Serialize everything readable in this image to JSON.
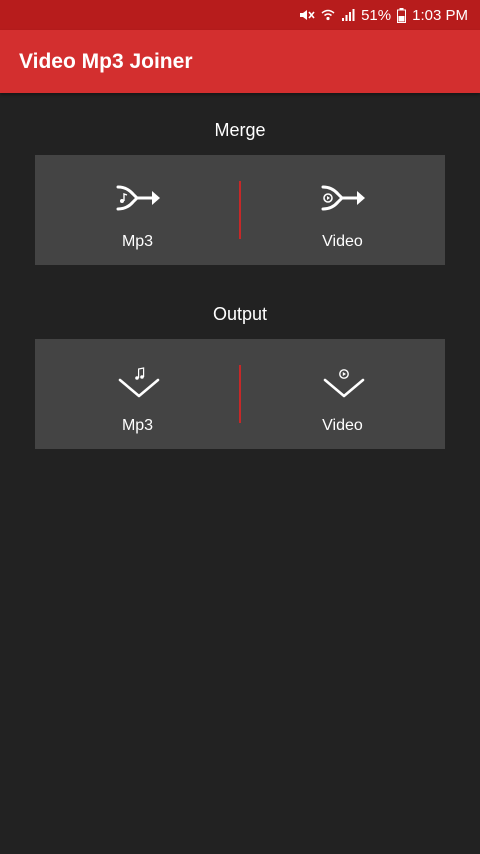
{
  "status_bar": {
    "battery": "51%",
    "time": "1:03 PM",
    "icons": [
      "mute-icon",
      "wifi-icon",
      "signal-icon",
      "battery-icon"
    ]
  },
  "app_bar": {
    "title": "Video Mp3 Joiner"
  },
  "merge": {
    "title": "Merge",
    "mp3_label": "Mp3",
    "video_label": "Video"
  },
  "output": {
    "title": "Output",
    "mp3_label": "Mp3",
    "video_label": "Video"
  },
  "colors": {
    "accent": "#d32f2f",
    "status_bar": "#b71c1c",
    "background": "#222222",
    "card": "#444444",
    "divider": "#c62828"
  }
}
